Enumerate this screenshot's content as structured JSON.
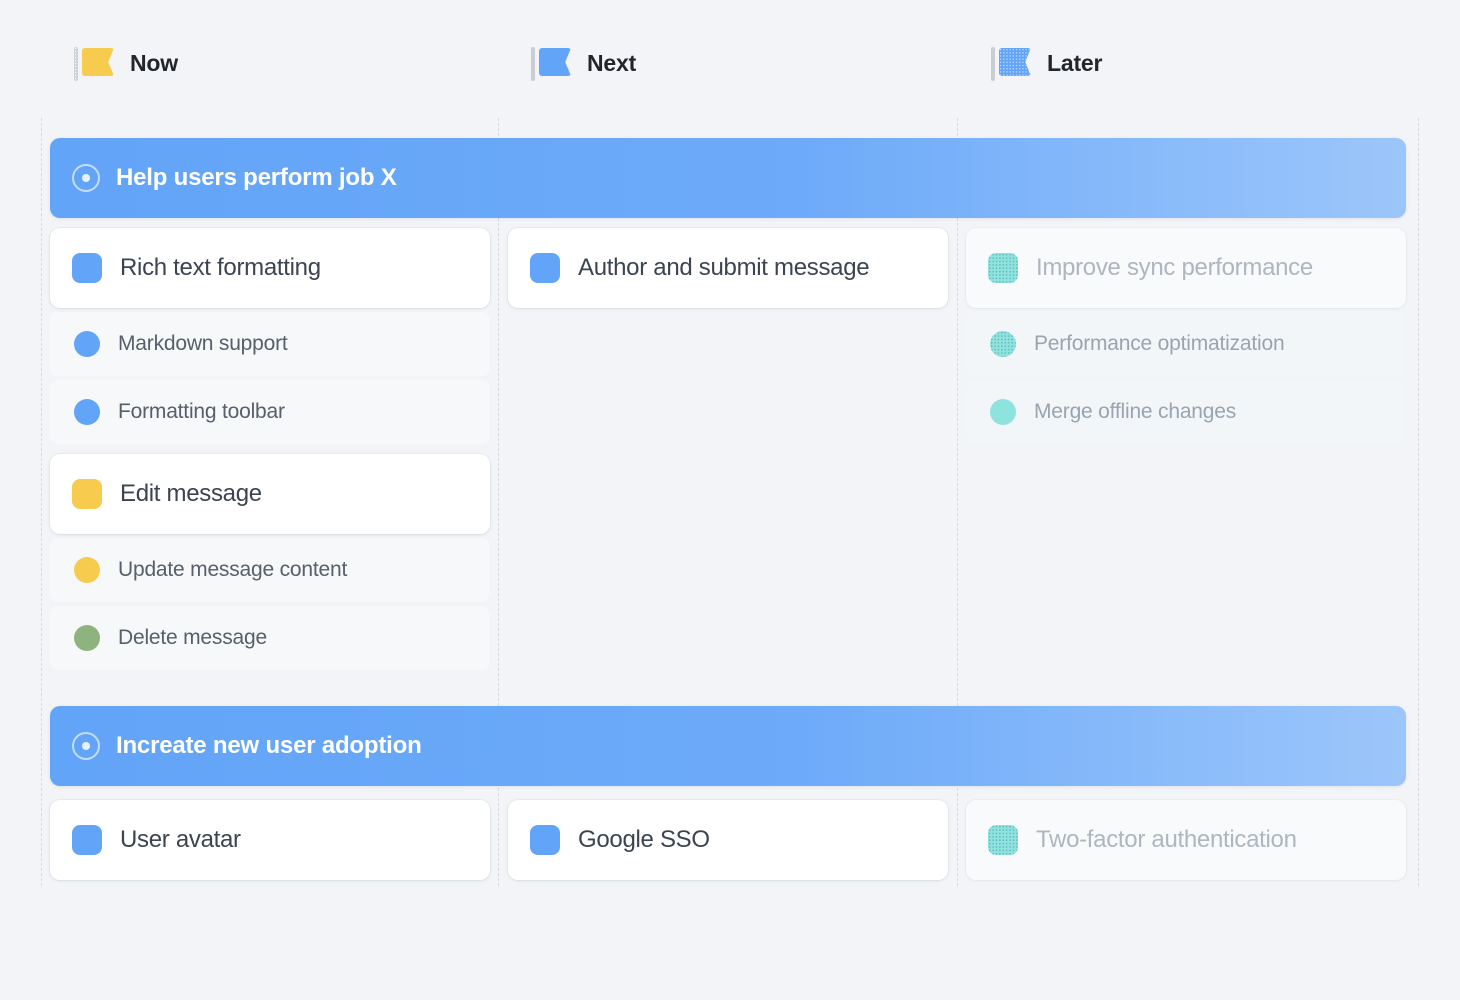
{
  "columns": [
    {
      "id": "now",
      "label": "Now",
      "flag_icon": "flag-icon-yellow"
    },
    {
      "id": "next",
      "label": "Next",
      "flag_icon": "flag-icon-blue"
    },
    {
      "id": "later",
      "label": "Later",
      "flag_icon": "flag-icon-blue-dotted"
    }
  ],
  "goals": [
    {
      "id": "goal-1",
      "label": "Help users perform job X",
      "icon": "target-icon"
    },
    {
      "id": "goal-2",
      "label": "Increate new user adoption",
      "icon": "target-icon"
    }
  ],
  "goal_1": {
    "now": {
      "groups": [
        {
          "card": {
            "label": "Rich text formatting",
            "marker": "blue"
          },
          "items": [
            {
              "label": "Markdown support",
              "marker": "blue"
            },
            {
              "label": "Formatting toolbar",
              "marker": "blue"
            }
          ]
        },
        {
          "card": {
            "label": "Edit message",
            "marker": "yellow"
          },
          "items": [
            {
              "label": "Update message content",
              "marker": "yellow"
            },
            {
              "label": "Delete message",
              "marker": "green"
            }
          ]
        }
      ]
    },
    "next": {
      "groups": [
        {
          "card": {
            "label": "Author and submit message",
            "marker": "blue"
          },
          "items": []
        }
      ]
    },
    "later": {
      "groups": [
        {
          "card": {
            "label": "Improve sync performance",
            "marker": "teal-dotted"
          },
          "items": [
            {
              "label": "Performance optimatization",
              "marker": "teal-dotted"
            },
            {
              "label": "Merge offline changes",
              "marker": "teal"
            }
          ]
        }
      ]
    }
  },
  "goal_2": {
    "now": {
      "card": {
        "label": "User avatar",
        "marker": "blue"
      }
    },
    "next": {
      "card": {
        "label": "Google SSO",
        "marker": "blue"
      }
    },
    "later": {
      "card": {
        "label": "Two-factor authentication",
        "marker": "teal-dotted"
      }
    }
  },
  "colors": {
    "background": "#F2F4F7",
    "accent_blue": "#62A4F8",
    "accent_yellow": "#F7CB4E",
    "accent_green": "#8FB37E",
    "accent_teal": "#8FE3DF",
    "card_white": "#FFFFFF",
    "subrow_gray": "#F6F8FA",
    "separator": "#D6DAE0"
  }
}
